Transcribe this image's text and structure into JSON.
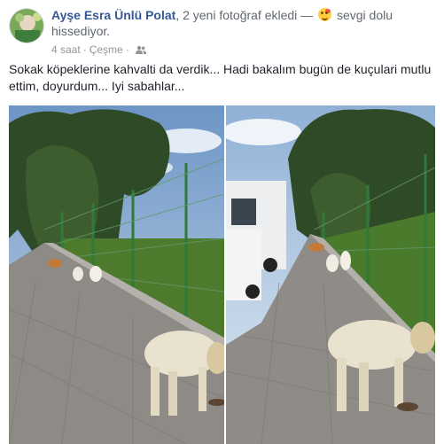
{
  "post": {
    "author": "Ayşe Esra Ünlü Polat",
    "action": ", 2 yeni fotoğraf ekledi —",
    "feeling_text": "sevgi dolu hissediyor.",
    "time": "4 saat",
    "location": "Çeşme",
    "body": "Sokak köpeklerine kahvalti da verdik... Hadi bakalım bugün de kuçulari mutlu ettim, doyurdum... Iyi sabahlar..."
  },
  "icons": {
    "feeling": "smiling-face-with-hearts-icon",
    "audience": "friends-icon",
    "options": "more-options-icon"
  },
  "colors": {
    "author_link": "#365899",
    "meta": "#90949c",
    "text": "#1d2129"
  }
}
